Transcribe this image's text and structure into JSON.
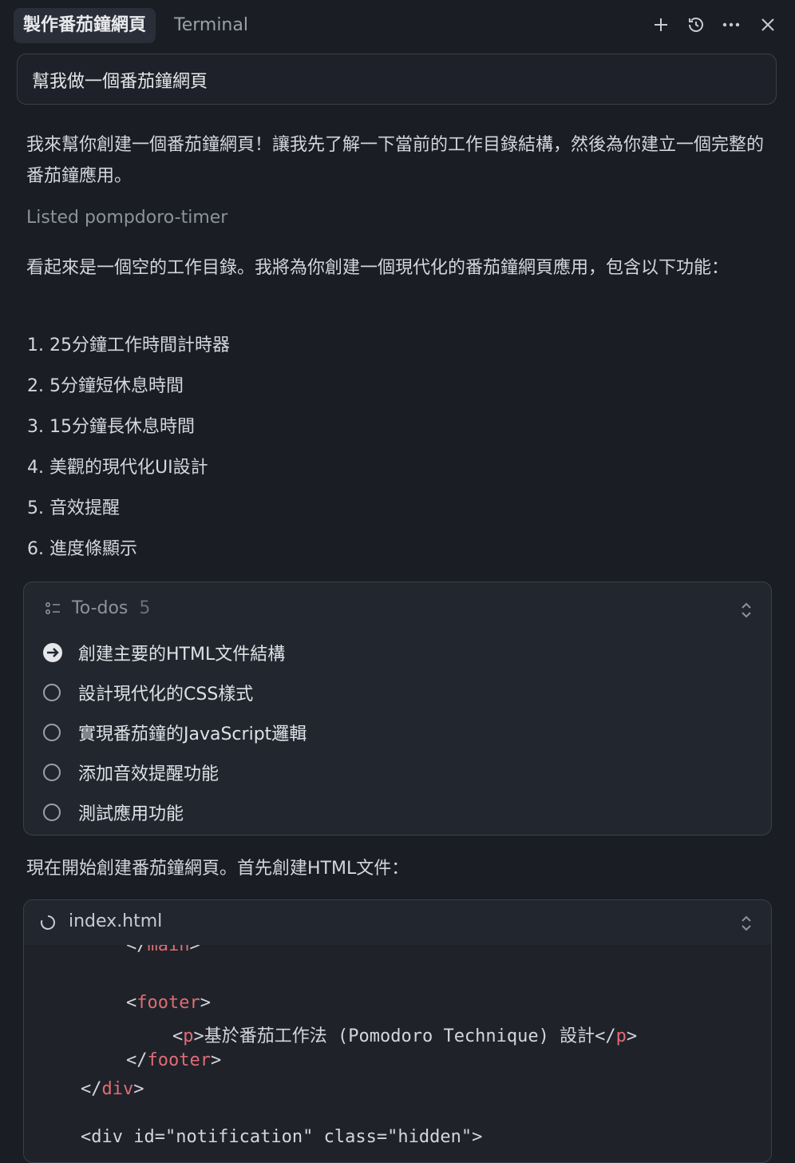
{
  "tabs": {
    "active": "製作番茄鐘網頁",
    "terminal": "Terminal"
  },
  "prompt": "幫我做一個番茄鐘網頁",
  "response": {
    "intro": "我來幫你創建一個番茄鐘網頁！讓我先了解一下當前的工作目錄結構，然後為你建立一個完整的番茄鐘應用。",
    "listed_label": "Listed",
    "listed_name": "pompdoro-timer",
    "empty_dir": "看起來是一個空的工作目錄。我將為你創建一個現代化的番茄鐘網頁應用，包含以下功能：",
    "features": [
      "1. 25分鐘工作時間計時器",
      "2. 5分鐘短休息時間",
      "3. 15分鐘長休息時間",
      "4. 美觀的現代化UI設計",
      "5. 音效提醒",
      "6. 進度條顯示"
    ],
    "start": "現在開始創建番茄鐘網頁。首先創建HTML文件："
  },
  "todos": {
    "label": "To-dos",
    "count": "5",
    "items": [
      {
        "text": "創建主要的HTML文件結構",
        "status": "in-progress"
      },
      {
        "text": "設計現代化的CSS樣式",
        "status": "pending"
      },
      {
        "text": "實現番茄鐘的JavaScript邏輯",
        "status": "pending"
      },
      {
        "text": "添加音效提醒功能",
        "status": "pending"
      },
      {
        "text": "測試應用功能",
        "status": "pending"
      }
    ]
  },
  "file": {
    "name": "index.html",
    "code": {
      "l0_tag": "main",
      "l1_tag": "footer",
      "l2_open": "p",
      "l2_text": "基於番茄工作法 (Pomodoro Technique) 設計",
      "l2_close": "p",
      "l3_tag": "footer",
      "l4_tag": "div",
      "l5_partial": "<div id=\"notification\" class=\"hidden\">"
    }
  },
  "colors": {
    "background": "#1a1d24",
    "tag": "#e06c75",
    "border": "#3a3f4a"
  }
}
